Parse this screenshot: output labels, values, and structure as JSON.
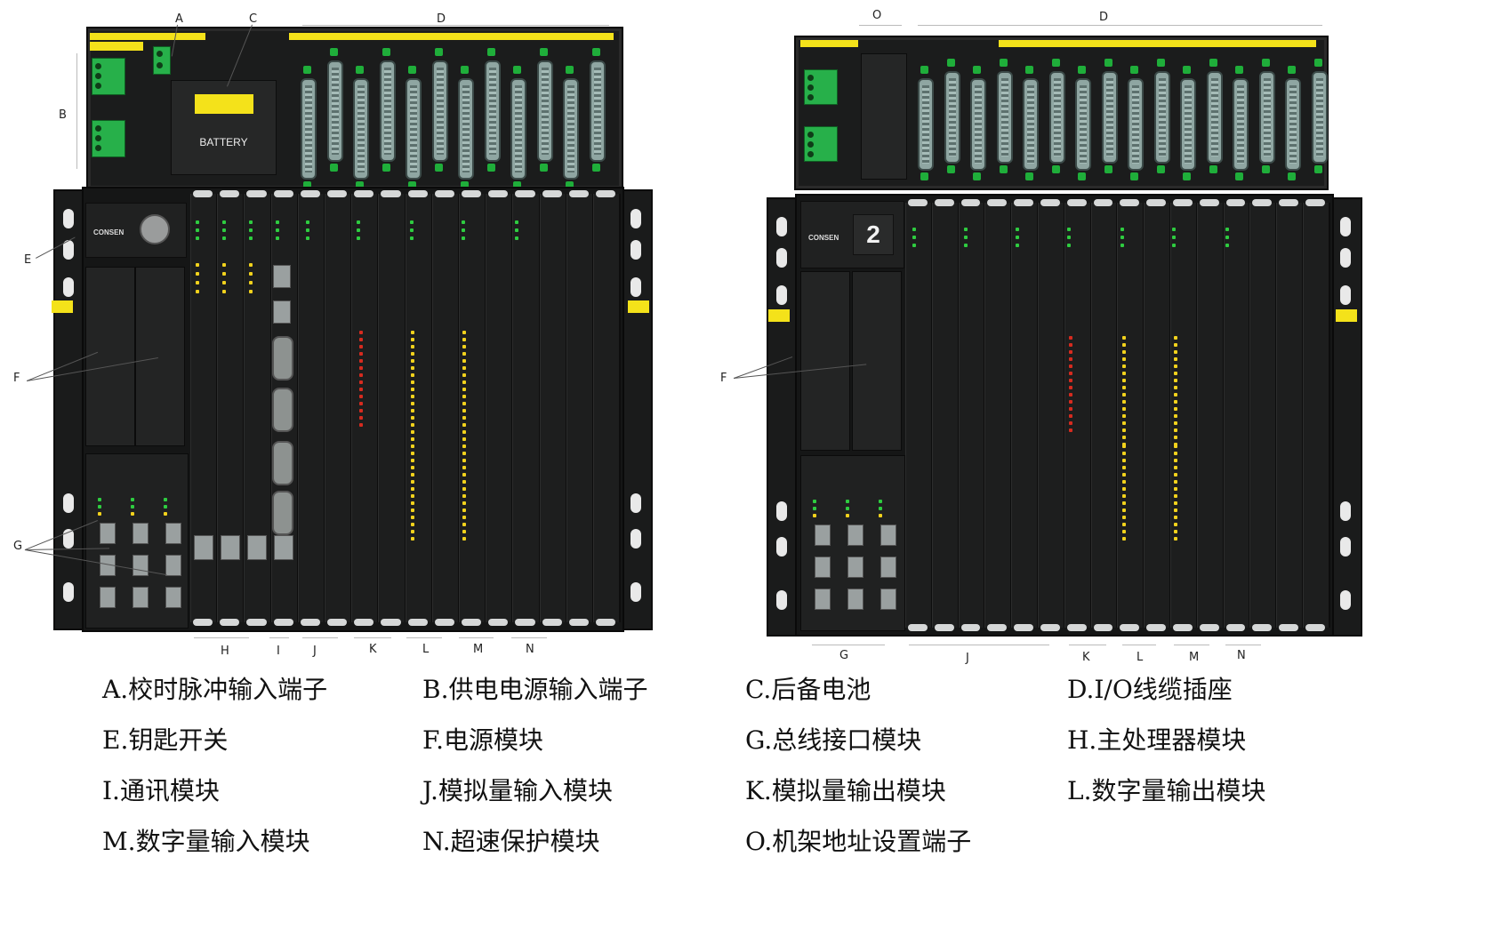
{
  "callouts_left": [
    "A",
    "B",
    "C",
    "D",
    "E",
    "F",
    "G",
    "H",
    "I",
    "J",
    "K",
    "L",
    "M",
    "N"
  ],
  "callouts_right": [
    "O",
    "D",
    "F",
    "G",
    "J",
    "K",
    "L",
    "M",
    "N"
  ],
  "battery_label": "BATTERY",
  "brand": "CONSEN",
  "rack_number": "2",
  "colors": {
    "panel": "#1b1c1c",
    "warning_yellow": "#f4e21a",
    "connector": "#8fa6a2",
    "terminal_green": "#27b04a"
  },
  "legend": [
    [
      "A.校时脉冲输入端子",
      "B.供电电源输入端子",
      "C.后备电池",
      "D.I/O线缆插座"
    ],
    [
      "E.钥匙开关",
      "F.电源模块",
      "G.总线接口模块",
      "H.主处理器模块"
    ],
    [
      "I.通讯模块",
      "J.模拟量输入模块",
      "K.模拟量输出模块",
      "L.数字量输出模块"
    ],
    [
      "M.数字量输入模块",
      "N.超速保护模块",
      "O.机架地址设置端子",
      ""
    ]
  ]
}
